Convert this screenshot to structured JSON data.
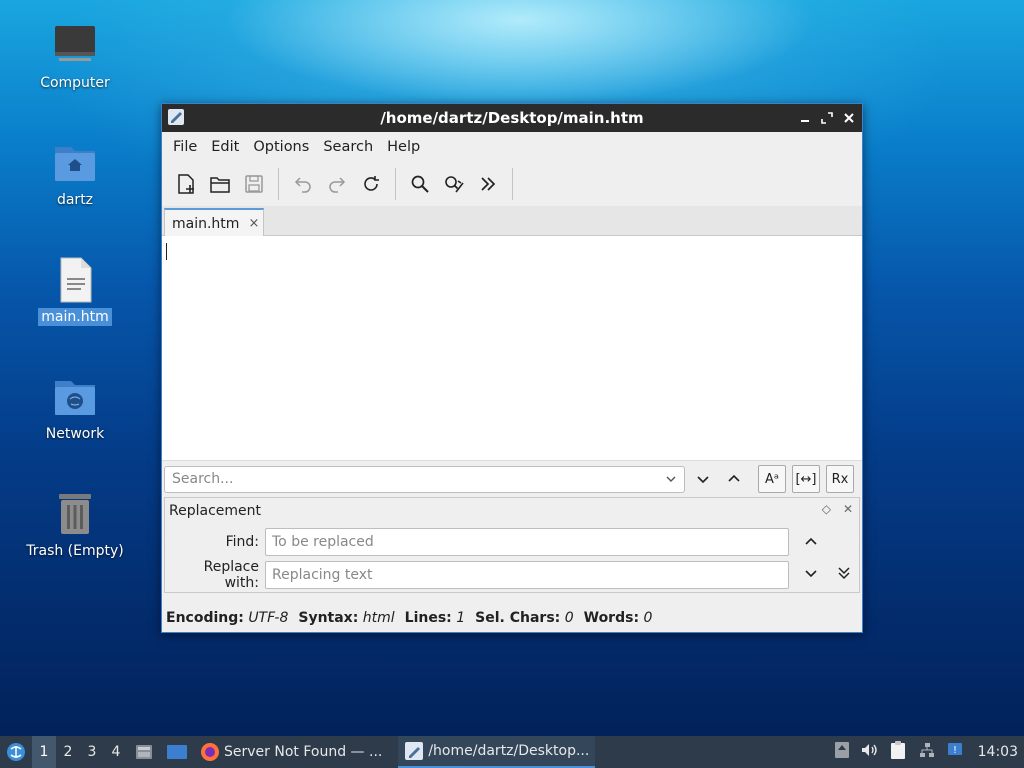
{
  "desktop": {
    "icons": [
      {
        "label": "Computer",
        "icon": "computer-icon"
      },
      {
        "label": "dartz",
        "icon": "home-folder-icon"
      },
      {
        "label": "main.htm",
        "icon": "text-file-icon",
        "selected": true
      },
      {
        "label": "Network",
        "icon": "network-folder-icon"
      },
      {
        "label": "Trash (Empty)",
        "icon": "trash-icon"
      }
    ]
  },
  "window": {
    "title": "/home/dartz/Desktop/main.htm",
    "menu": [
      "File",
      "Edit",
      "Options",
      "Search",
      "Help"
    ],
    "toolbar": [
      "new-file-icon",
      "open-folder-icon",
      "save-icon",
      "undo-icon",
      "redo-icon",
      "reload-icon",
      "find-icon",
      "replace-icon",
      "more-icon"
    ],
    "tab": {
      "label": "main.htm",
      "close": "×"
    },
    "search": {
      "placeholder": "Search...",
      "case_btn": "Aᵃ",
      "whole_word_btn": "[↔]",
      "regex_btn": "Rx"
    },
    "replacement": {
      "title": "Replacement",
      "find_label": "Find:",
      "find_placeholder": "To be replaced",
      "replace_label": "Replace with:",
      "replace_placeholder": "Replacing text"
    },
    "status": {
      "encoding_label": "Encoding:",
      "encoding": "UTF-8",
      "syntax_label": "Syntax:",
      "syntax": "html",
      "lines_label": "Lines:",
      "lines": "1",
      "sel_label": "Sel. Chars:",
      "sel": "0",
      "words_label": "Words:",
      "words": "0"
    }
  },
  "taskbar": {
    "workspaces": [
      "1",
      "2",
      "3",
      "4"
    ],
    "tasks": [
      {
        "label": "Server Not Found — ...",
        "icon": "firefox-icon"
      },
      {
        "label": "/home/dartz/Desktop...",
        "icon": "text-editor-icon"
      }
    ],
    "clock": "14:03"
  },
  "colors": {
    "accent": "#4a90d9",
    "titlebar": "#2b2b2b",
    "taskbar": "#2d3b4a"
  }
}
